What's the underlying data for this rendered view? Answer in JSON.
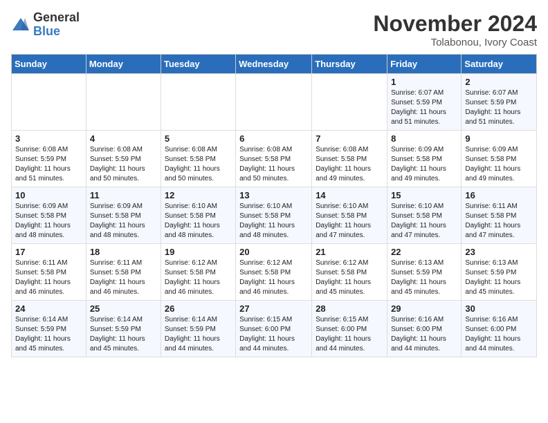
{
  "header": {
    "logo_general": "General",
    "logo_blue": "Blue",
    "month_title": "November 2024",
    "subtitle": "Tolabonou, Ivory Coast"
  },
  "days_of_week": [
    "Sunday",
    "Monday",
    "Tuesday",
    "Wednesday",
    "Thursday",
    "Friday",
    "Saturday"
  ],
  "weeks": [
    [
      {
        "day": "",
        "sunrise": "",
        "sunset": "",
        "daylight": ""
      },
      {
        "day": "",
        "sunrise": "",
        "sunset": "",
        "daylight": ""
      },
      {
        "day": "",
        "sunrise": "",
        "sunset": "",
        "daylight": ""
      },
      {
        "day": "",
        "sunrise": "",
        "sunset": "",
        "daylight": ""
      },
      {
        "day": "",
        "sunrise": "",
        "sunset": "",
        "daylight": ""
      },
      {
        "day": "1",
        "sunrise": "Sunrise: 6:07 AM",
        "sunset": "Sunset: 5:59 PM",
        "daylight": "Daylight: 11 hours and 51 minutes."
      },
      {
        "day": "2",
        "sunrise": "Sunrise: 6:07 AM",
        "sunset": "Sunset: 5:59 PM",
        "daylight": "Daylight: 11 hours and 51 minutes."
      }
    ],
    [
      {
        "day": "3",
        "sunrise": "Sunrise: 6:08 AM",
        "sunset": "Sunset: 5:59 PM",
        "daylight": "Daylight: 11 hours and 51 minutes."
      },
      {
        "day": "4",
        "sunrise": "Sunrise: 6:08 AM",
        "sunset": "Sunset: 5:59 PM",
        "daylight": "Daylight: 11 hours and 50 minutes."
      },
      {
        "day": "5",
        "sunrise": "Sunrise: 6:08 AM",
        "sunset": "Sunset: 5:58 PM",
        "daylight": "Daylight: 11 hours and 50 minutes."
      },
      {
        "day": "6",
        "sunrise": "Sunrise: 6:08 AM",
        "sunset": "Sunset: 5:58 PM",
        "daylight": "Daylight: 11 hours and 50 minutes."
      },
      {
        "day": "7",
        "sunrise": "Sunrise: 6:08 AM",
        "sunset": "Sunset: 5:58 PM",
        "daylight": "Daylight: 11 hours and 49 minutes."
      },
      {
        "day": "8",
        "sunrise": "Sunrise: 6:09 AM",
        "sunset": "Sunset: 5:58 PM",
        "daylight": "Daylight: 11 hours and 49 minutes."
      },
      {
        "day": "9",
        "sunrise": "Sunrise: 6:09 AM",
        "sunset": "Sunset: 5:58 PM",
        "daylight": "Daylight: 11 hours and 49 minutes."
      }
    ],
    [
      {
        "day": "10",
        "sunrise": "Sunrise: 6:09 AM",
        "sunset": "Sunset: 5:58 PM",
        "daylight": "Daylight: 11 hours and 48 minutes."
      },
      {
        "day": "11",
        "sunrise": "Sunrise: 6:09 AM",
        "sunset": "Sunset: 5:58 PM",
        "daylight": "Daylight: 11 hours and 48 minutes."
      },
      {
        "day": "12",
        "sunrise": "Sunrise: 6:10 AM",
        "sunset": "Sunset: 5:58 PM",
        "daylight": "Daylight: 11 hours and 48 minutes."
      },
      {
        "day": "13",
        "sunrise": "Sunrise: 6:10 AM",
        "sunset": "Sunset: 5:58 PM",
        "daylight": "Daylight: 11 hours and 48 minutes."
      },
      {
        "day": "14",
        "sunrise": "Sunrise: 6:10 AM",
        "sunset": "Sunset: 5:58 PM",
        "daylight": "Daylight: 11 hours and 47 minutes."
      },
      {
        "day": "15",
        "sunrise": "Sunrise: 6:10 AM",
        "sunset": "Sunset: 5:58 PM",
        "daylight": "Daylight: 11 hours and 47 minutes."
      },
      {
        "day": "16",
        "sunrise": "Sunrise: 6:11 AM",
        "sunset": "Sunset: 5:58 PM",
        "daylight": "Daylight: 11 hours and 47 minutes."
      }
    ],
    [
      {
        "day": "17",
        "sunrise": "Sunrise: 6:11 AM",
        "sunset": "Sunset: 5:58 PM",
        "daylight": "Daylight: 11 hours and 46 minutes."
      },
      {
        "day": "18",
        "sunrise": "Sunrise: 6:11 AM",
        "sunset": "Sunset: 5:58 PM",
        "daylight": "Daylight: 11 hours and 46 minutes."
      },
      {
        "day": "19",
        "sunrise": "Sunrise: 6:12 AM",
        "sunset": "Sunset: 5:58 PM",
        "daylight": "Daylight: 11 hours and 46 minutes."
      },
      {
        "day": "20",
        "sunrise": "Sunrise: 6:12 AM",
        "sunset": "Sunset: 5:58 PM",
        "daylight": "Daylight: 11 hours and 46 minutes."
      },
      {
        "day": "21",
        "sunrise": "Sunrise: 6:12 AM",
        "sunset": "Sunset: 5:58 PM",
        "daylight": "Daylight: 11 hours and 45 minutes."
      },
      {
        "day": "22",
        "sunrise": "Sunrise: 6:13 AM",
        "sunset": "Sunset: 5:59 PM",
        "daylight": "Daylight: 11 hours and 45 minutes."
      },
      {
        "day": "23",
        "sunrise": "Sunrise: 6:13 AM",
        "sunset": "Sunset: 5:59 PM",
        "daylight": "Daylight: 11 hours and 45 minutes."
      }
    ],
    [
      {
        "day": "24",
        "sunrise": "Sunrise: 6:14 AM",
        "sunset": "Sunset: 5:59 PM",
        "daylight": "Daylight: 11 hours and 45 minutes."
      },
      {
        "day": "25",
        "sunrise": "Sunrise: 6:14 AM",
        "sunset": "Sunset: 5:59 PM",
        "daylight": "Daylight: 11 hours and 45 minutes."
      },
      {
        "day": "26",
        "sunrise": "Sunrise: 6:14 AM",
        "sunset": "Sunset: 5:59 PM",
        "daylight": "Daylight: 11 hours and 44 minutes."
      },
      {
        "day": "27",
        "sunrise": "Sunrise: 6:15 AM",
        "sunset": "Sunset: 6:00 PM",
        "daylight": "Daylight: 11 hours and 44 minutes."
      },
      {
        "day": "28",
        "sunrise": "Sunrise: 6:15 AM",
        "sunset": "Sunset: 6:00 PM",
        "daylight": "Daylight: 11 hours and 44 minutes."
      },
      {
        "day": "29",
        "sunrise": "Sunrise: 6:16 AM",
        "sunset": "Sunset: 6:00 PM",
        "daylight": "Daylight: 11 hours and 44 minutes."
      },
      {
        "day": "30",
        "sunrise": "Sunrise: 6:16 AM",
        "sunset": "Sunset: 6:00 PM",
        "daylight": "Daylight: 11 hours and 44 minutes."
      }
    ]
  ]
}
